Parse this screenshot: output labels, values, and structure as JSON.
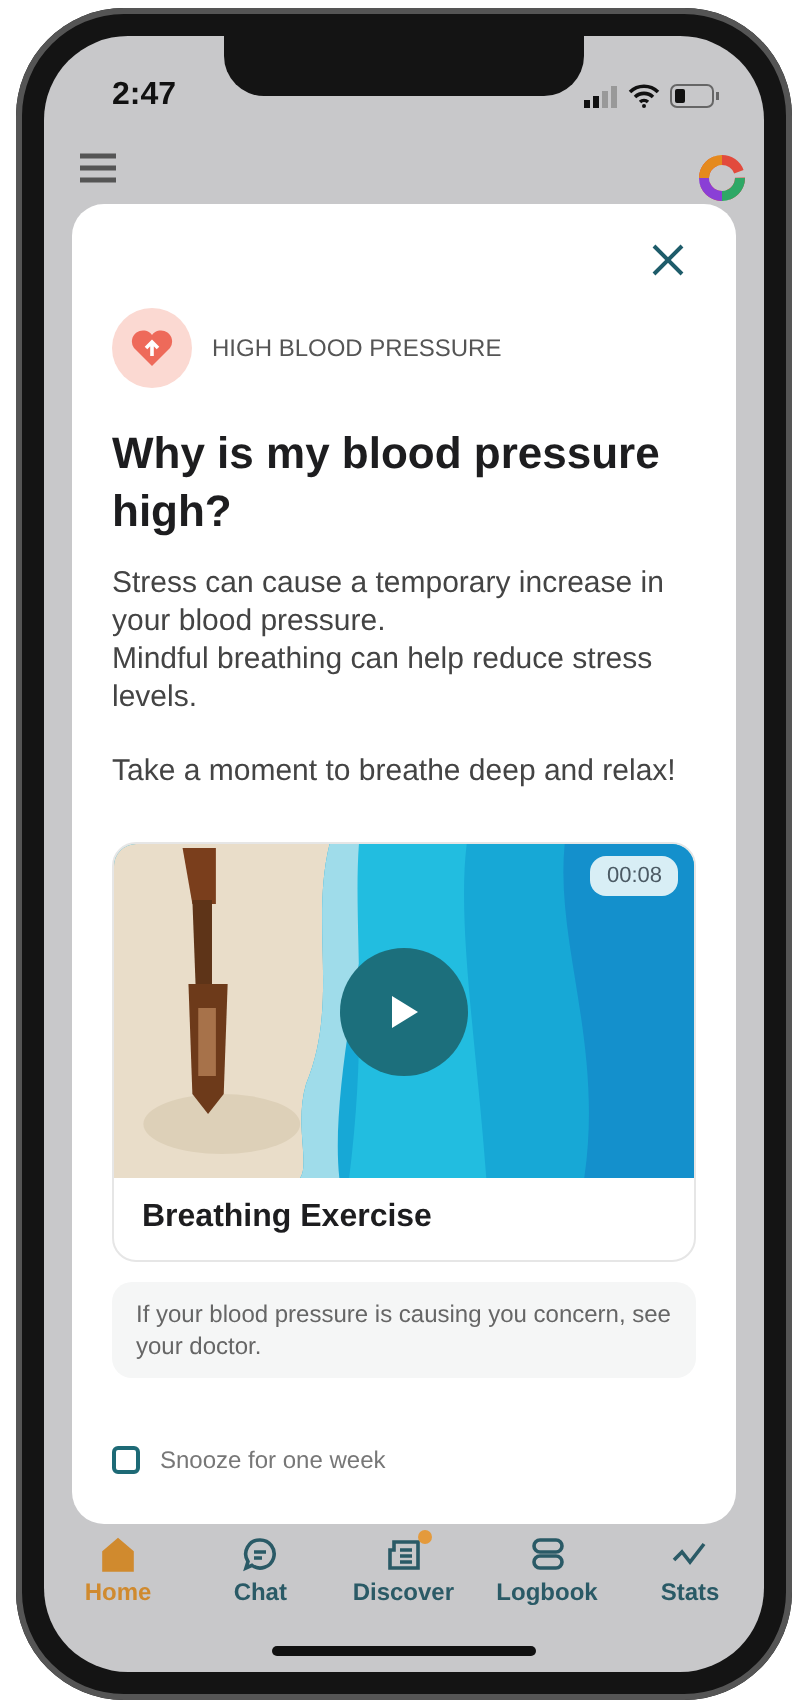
{
  "status_bar": {
    "time": "2:47"
  },
  "modal": {
    "category": "HIGH BLOOD PRESSURE",
    "title": "Why is my blood pressure high?",
    "paragraphs": [
      "Stress can cause a temporary increase in your blood pressure.\nMindful breathing can help reduce stress levels.",
      "Take a moment to breathe deep and relax!"
    ],
    "video": {
      "kind": "picture",
      "duration": "00:08",
      "title": "Breathing Exercise"
    },
    "note": "If your blood pressure is causing you concern, see your doctor.",
    "snooze": {
      "label": "Snooze for one week",
      "checked": false
    }
  },
  "tabs": [
    {
      "label": "Home",
      "kind": "home",
      "selected": true,
      "dot": false
    },
    {
      "label": "Chat",
      "kind": "chat",
      "selected": false,
      "dot": false
    },
    {
      "label": "Discover",
      "kind": "discover",
      "selected": false,
      "dot": true
    },
    {
      "label": "Logbook",
      "kind": "logbook",
      "selected": false,
      "dot": false
    },
    {
      "label": "Stats",
      "kind": "stats",
      "selected": false,
      "dot": false
    }
  ]
}
